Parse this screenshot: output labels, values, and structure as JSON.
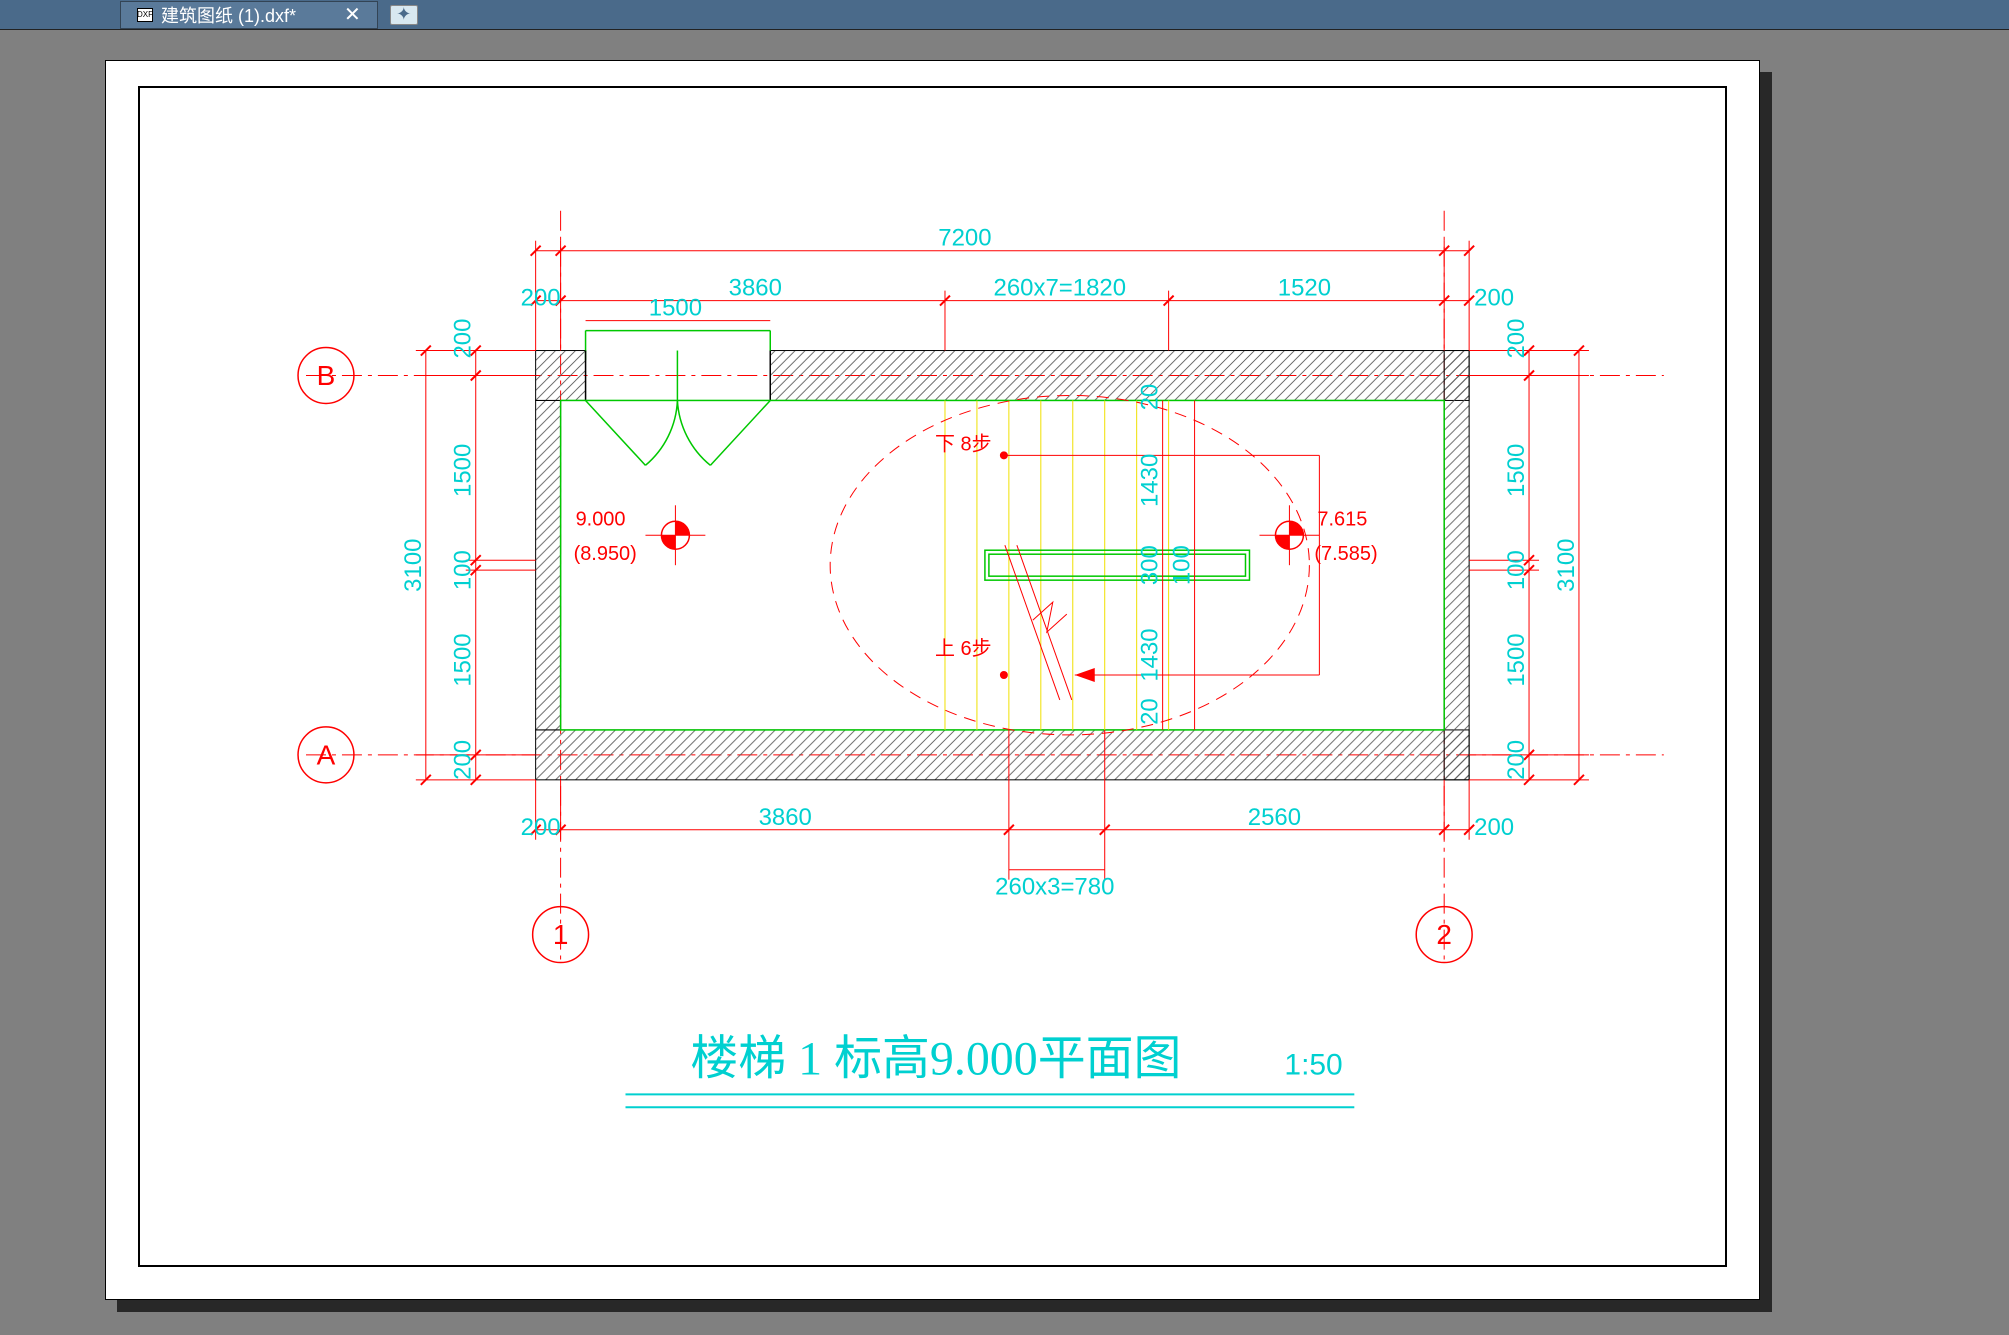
{
  "tab": {
    "icon": "DXF",
    "filename": "建筑图纸 (1).dxf*"
  },
  "title": {
    "main": "楼梯 1 标高9.000平面图",
    "scale": "1:50"
  },
  "dims": {
    "top_overall": "7200",
    "top_l200": "200",
    "top_3860": "3860",
    "top_steps7": "260x7=1820",
    "top_1520": "1520",
    "top_r200": "200",
    "door_1500": "1500",
    "left_200t": "200",
    "left_1500t": "1500",
    "left_100": "100",
    "left_1500b": "1500",
    "left_200b": "200",
    "left_3100": "3100",
    "right_200t": "200",
    "right_1500t": "1500",
    "right_100": "100",
    "right_1500b": "1500",
    "right_200b": "200",
    "right_3100": "3100",
    "inner_20t": "20",
    "inner_1430t": "1430",
    "inner_300": "300",
    "inner_100": "100",
    "inner_1430b": "1430",
    "inner_20b": "20",
    "bot_l200": "200",
    "bot_3860": "3860",
    "bot_2560": "2560",
    "bot_r200": "200",
    "bot_steps3": "260x3=780"
  },
  "elev": {
    "left_val": "9.000",
    "left_paren": "(8.950)",
    "right_val": "7.615",
    "right_paren": "(7.585)"
  },
  "stair": {
    "down_label": "下 8步",
    "up_label": "上 6步"
  },
  "axes": {
    "a": "A",
    "b": "B",
    "one": "1",
    "two": "2"
  }
}
